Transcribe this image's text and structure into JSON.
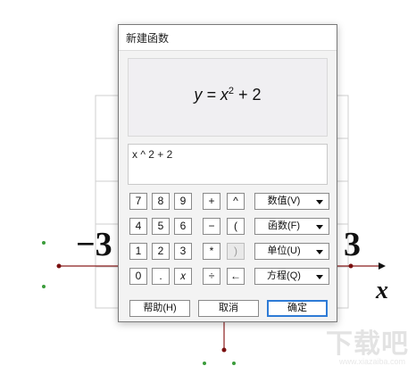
{
  "background": {
    "tick_left": "−3",
    "tick_right": "3",
    "axis_label": "x",
    "watermark": "下载吧",
    "watermark_url": "www.xiazaiba.com"
  },
  "dialog": {
    "title": "新建函数",
    "preview": {
      "lhs": "y = x",
      "exponent": "2",
      "rhs": " + 2"
    },
    "input_value": "x ^ 2 + 2",
    "keypad": {
      "row1": [
        "7",
        "8",
        "9",
        "+",
        "^"
      ],
      "row2": [
        "4",
        "5",
        "6",
        "−",
        "("
      ],
      "row3": [
        "1",
        "2",
        "3",
        "*",
        ")"
      ],
      "row4": [
        "0",
        ".",
        "𝑥",
        "÷",
        "←"
      ]
    },
    "dropdowns": [
      "数值(V)",
      "函数(F)",
      "单位(U)",
      "方程(Q)"
    ],
    "buttons": {
      "help": "帮助(H)",
      "cancel": "取消",
      "ok": "确定"
    }
  }
}
